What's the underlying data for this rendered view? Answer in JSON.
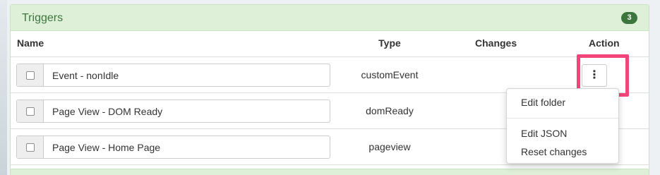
{
  "panel": {
    "title": "Triggers",
    "count": "3"
  },
  "columns": {
    "name": "Name",
    "type": "Type",
    "changes": "Changes",
    "action": "Action"
  },
  "rows": [
    {
      "name": "Event - nonIdle",
      "type": "customEvent",
      "changes": ""
    },
    {
      "name": "Page View - DOM Ready",
      "type": "domReady",
      "changes": ""
    },
    {
      "name": "Page View - Home Page",
      "type": "pageview",
      "changes": ""
    }
  ],
  "action_button": {
    "icon": "vertical-ellipsis-icon",
    "glyph": "⋮"
  },
  "dropdown": {
    "items": [
      "Edit folder",
      "Edit JSON",
      "Reset changes"
    ]
  },
  "colors": {
    "header_bg": "#dff0d8",
    "header_text": "#3c763d",
    "highlight": "#f2457a"
  }
}
